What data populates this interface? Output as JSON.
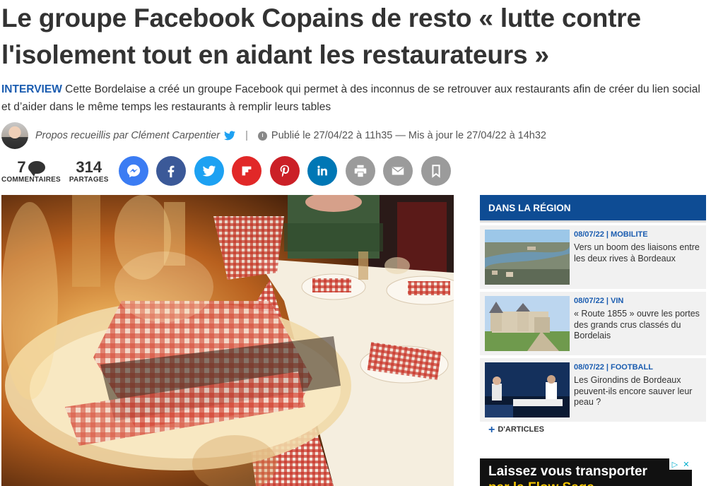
{
  "article": {
    "title": "Le groupe Facebook Copains de resto « lutte contre l'isolement tout en aidant les restaurateurs »",
    "tag": "INTERVIEW",
    "lead": "Cette Bordelaise a créé un groupe Facebook qui permet à des inconnus de se retrouver aux restaurants afin de créer du lien social et d’aider dans le même temps les restaurants à remplir leurs tables",
    "author": "Propos recueillis par Clément Carpentier",
    "separator": "|",
    "published": "Publié le 27/04/22 à 11h35 — Mis à jour le 27/04/22 à 14h32"
  },
  "share": {
    "comments_count": "7",
    "comments_label": "COMMENTAIRES",
    "shares_count": "314",
    "shares_label": "PARTAGES",
    "buttons": [
      {
        "name": "messenger",
        "color": "#3b7cf3"
      },
      {
        "name": "facebook",
        "color": "#3b5998"
      },
      {
        "name": "twitter",
        "color": "#1da1f2"
      },
      {
        "name": "flipboard",
        "color": "#e12828"
      },
      {
        "name": "pinterest",
        "color": "#cb2027"
      },
      {
        "name": "linkedin",
        "color": "#0077b5"
      },
      {
        "name": "print",
        "color": "#9b9b9b"
      },
      {
        "name": "email",
        "color": "#9b9b9b"
      },
      {
        "name": "bookmark",
        "color": "#9b9b9b"
      }
    ]
  },
  "sidebar": {
    "header": "DANS LA RÉGION",
    "items": [
      {
        "date": "08/07/22",
        "category": "MOBILITE",
        "title": "Vers un boom des liaisons entre les deux rives à Bordeaux"
      },
      {
        "date": "08/07/22",
        "category": "VIN",
        "title": "« Route 1855 » ouvre les portes des grands crus classés du Bordelais"
      },
      {
        "date": "08/07/22",
        "category": "FOOTBALL",
        "title": "Les Girondins de Bordeaux peuvent-ils encore sauver leur peau ?"
      }
    ],
    "more_label": "D'ARTICLES"
  },
  "ad": {
    "text": "Laissez vous transporter",
    "text2": "par la Flow Saga",
    "close_glyph": "✕"
  },
  "colors": {
    "accent_blue": "#1a5cb0",
    "header_blue": "#0e4c94"
  }
}
